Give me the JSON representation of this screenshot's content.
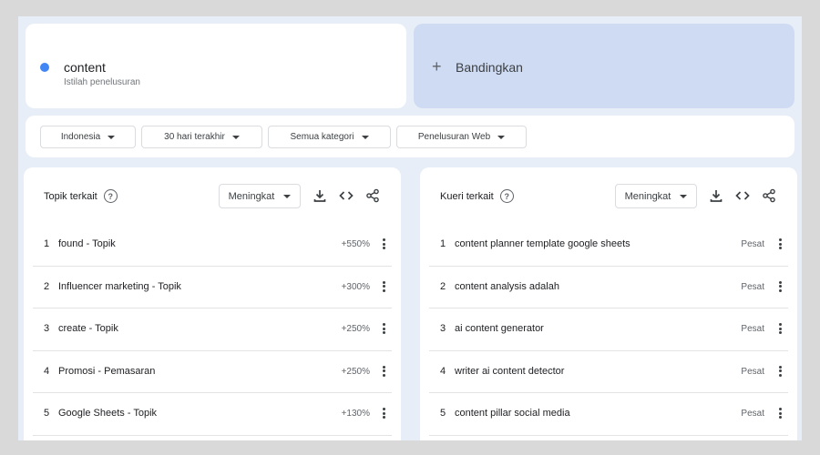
{
  "search_term": {
    "name": "content",
    "subtitle": "Istilah penelusuran",
    "dot_color": "#4285f4"
  },
  "compare": {
    "plus": "+",
    "label": "Bandingkan"
  },
  "filters": [
    "Indonesia",
    "30 hari terakhir",
    "Semua kategori",
    "Penelusuran Web"
  ],
  "panels": [
    {
      "title": "Topik terkait",
      "help": "?",
      "sort": "Meningkat",
      "icons": [
        "download-icon",
        "embed-icon",
        "share-icon"
      ],
      "rows": [
        {
          "rank": "1",
          "label": "found - Topik",
          "value": "+550%"
        },
        {
          "rank": "2",
          "label": "Influencer marketing - Topik",
          "value": "+300%"
        },
        {
          "rank": "3",
          "label": "create - Topik",
          "value": "+250%"
        },
        {
          "rank": "4",
          "label": "Promosi - Pemasaran",
          "value": "+250%"
        },
        {
          "rank": "5",
          "label": "Google Sheets - Topik",
          "value": "+130%"
        }
      ]
    },
    {
      "title": "Kueri terkait",
      "help": "?",
      "sort": "Meningkat",
      "icons": [
        "download-icon",
        "embed-icon",
        "share-icon"
      ],
      "rows": [
        {
          "rank": "1",
          "label": "content planner template google sheets",
          "value": "Pesat"
        },
        {
          "rank": "2",
          "label": "content analysis adalah",
          "value": "Pesat"
        },
        {
          "rank": "3",
          "label": "ai content generator",
          "value": "Pesat"
        },
        {
          "rank": "4",
          "label": "writer ai content detector",
          "value": "Pesat"
        },
        {
          "rank": "5",
          "label": "content pillar social media",
          "value": "Pesat"
        }
      ]
    }
  ]
}
